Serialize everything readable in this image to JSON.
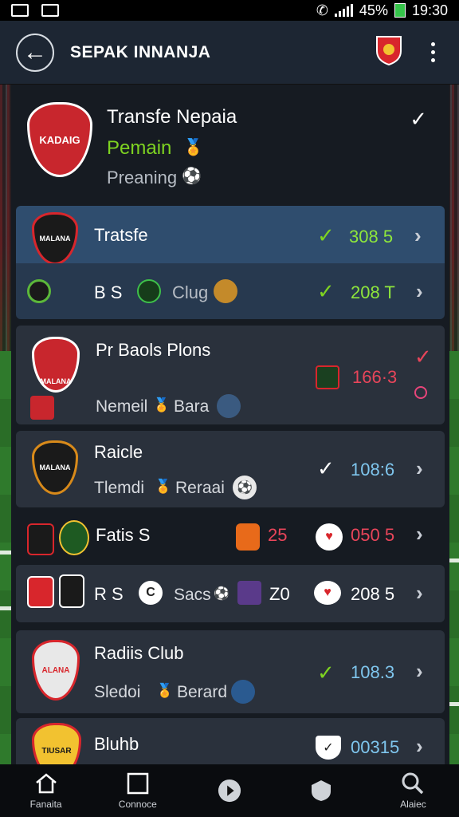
{
  "status_bar": {
    "battery": "45%",
    "time": "19:30"
  },
  "app_bar": {
    "title": "SEPAK INNANJA"
  },
  "header_card": {
    "crest_text": "KADAIG",
    "title": "Transfe Nepaia",
    "subtitle": "Pemain",
    "meta": "Preaning"
  },
  "rows": [
    {
      "crest_text": "MALANA",
      "name": "Tratsfe",
      "value": "308 5",
      "status": "check"
    },
    {
      "name_a": "B S",
      "name_b": "Clug",
      "value": "208 T",
      "status": "check"
    },
    {
      "name": "Pr Baols Plons",
      "sub_a": "Nemeil",
      "sub_b": "Bara",
      "value": "166·3",
      "crest_text": "MALANA"
    },
    {
      "crest_text": "MALANA",
      "name": "Raicle",
      "sub_a": "Tlemdi",
      "sub_b": "Reraai",
      "value": "108:6"
    },
    {
      "name": "Fatis S",
      "score": "25",
      "value": "050 5"
    },
    {
      "name": "R S",
      "sub": "Sacs",
      "score": "Z0",
      "value": "208 5"
    },
    {
      "crest_text": "ALANA",
      "name": "Radiis Club",
      "sub_a": "Sledoi",
      "sub_b": "Berard",
      "value": "108.3"
    },
    {
      "crest_text": "TIUSAR",
      "name": "Bluhb",
      "value": "00315"
    }
  ],
  "nav": [
    {
      "label": "Fanaita",
      "icon": "home-icon"
    },
    {
      "label": "Connoce",
      "icon": "square-icon"
    },
    {
      "label": "",
      "icon": "play-icon"
    },
    {
      "label": "",
      "icon": "shield-icon"
    },
    {
      "label": "Alaiec",
      "icon": "search-icon"
    }
  ],
  "colors": {
    "appbar": "#1d2633",
    "active": "#2f4d6e",
    "accent_green": "#7ed321",
    "accent_red": "#e8455a",
    "value_blue": "#7fc6ee"
  }
}
